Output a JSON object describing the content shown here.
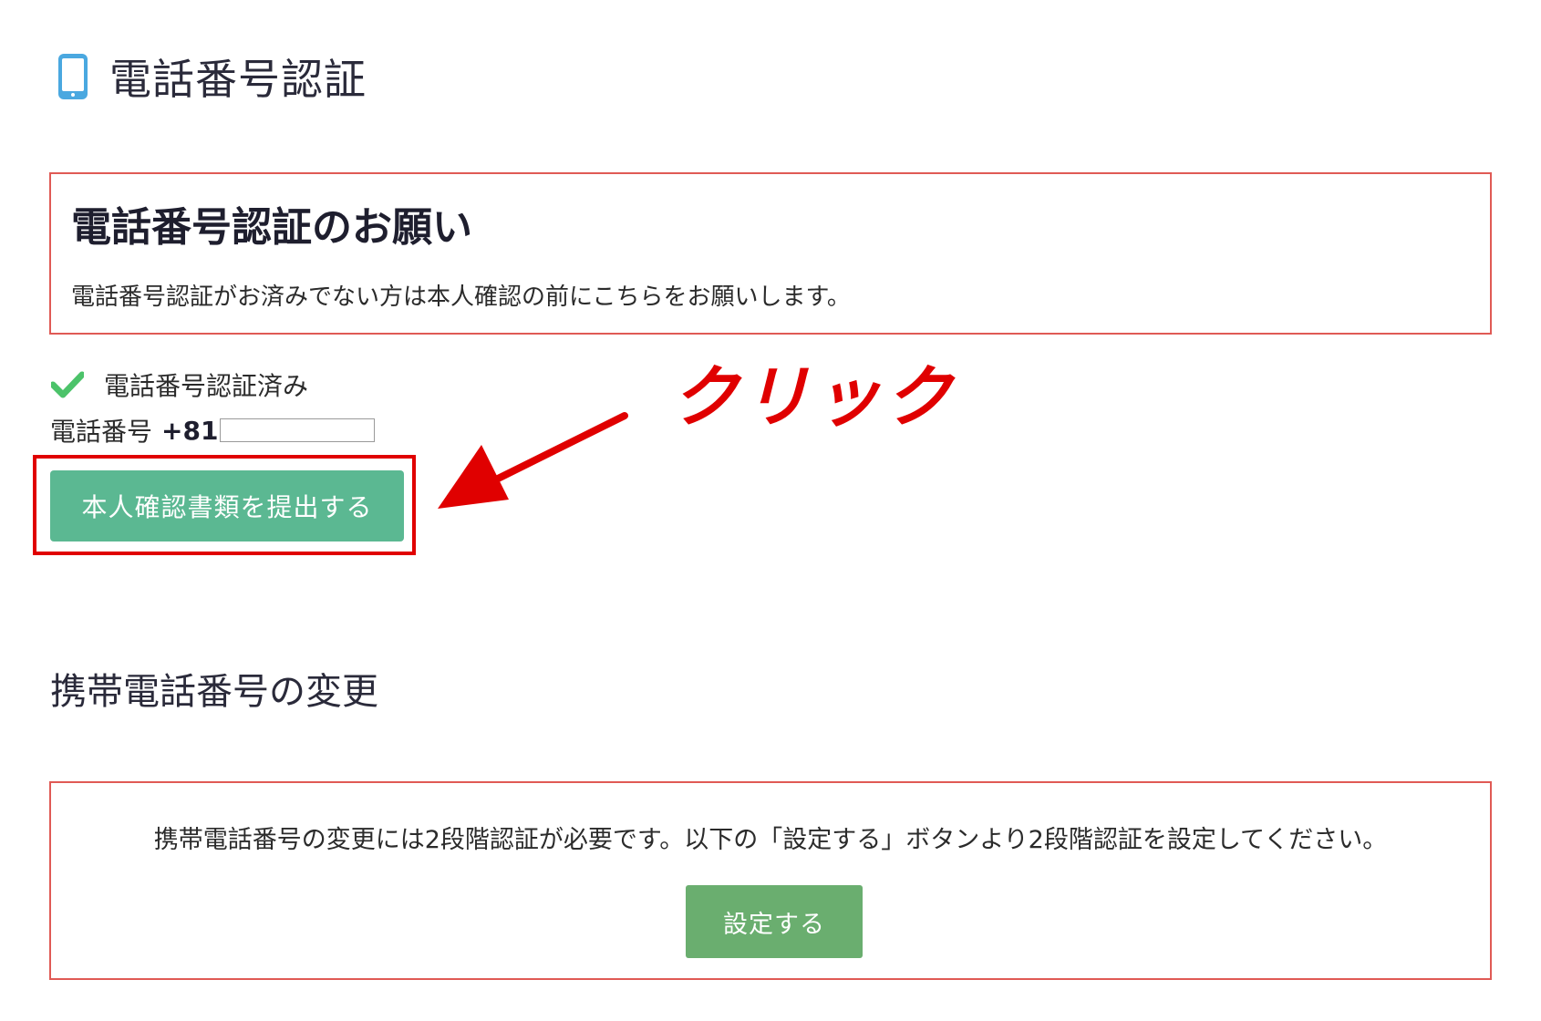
{
  "header": {
    "icon": "smartphone-icon",
    "title": "電話番号認証"
  },
  "request": {
    "title": "電話番号認証のお願い",
    "text": "電話番号認証がお済みでない方は本人確認の前にこちらをお願いします。"
  },
  "status": {
    "icon": "check-icon",
    "verified_text": "電話番号認証済み",
    "phone_label": "電話番号",
    "phone_code": "+81",
    "phone_value": ""
  },
  "submit": {
    "label": "本人確認書類を提出する"
  },
  "annotation": {
    "text": "クリック",
    "icon": "arrow-icon"
  },
  "change": {
    "title": "携帯電話番号の変更",
    "text": "携帯電話番号の変更には2段階認証が必要です。以下の「設定する」ボタンより2段階認証を設定してください。",
    "button_label": "設定する"
  },
  "colors": {
    "accent_green": "#5bb892",
    "button_green": "#6aae6f",
    "border_red": "#e05a55",
    "annotation_red": "#e00000",
    "icon_blue": "#4aa8e0",
    "check_green": "#4cc36a"
  }
}
